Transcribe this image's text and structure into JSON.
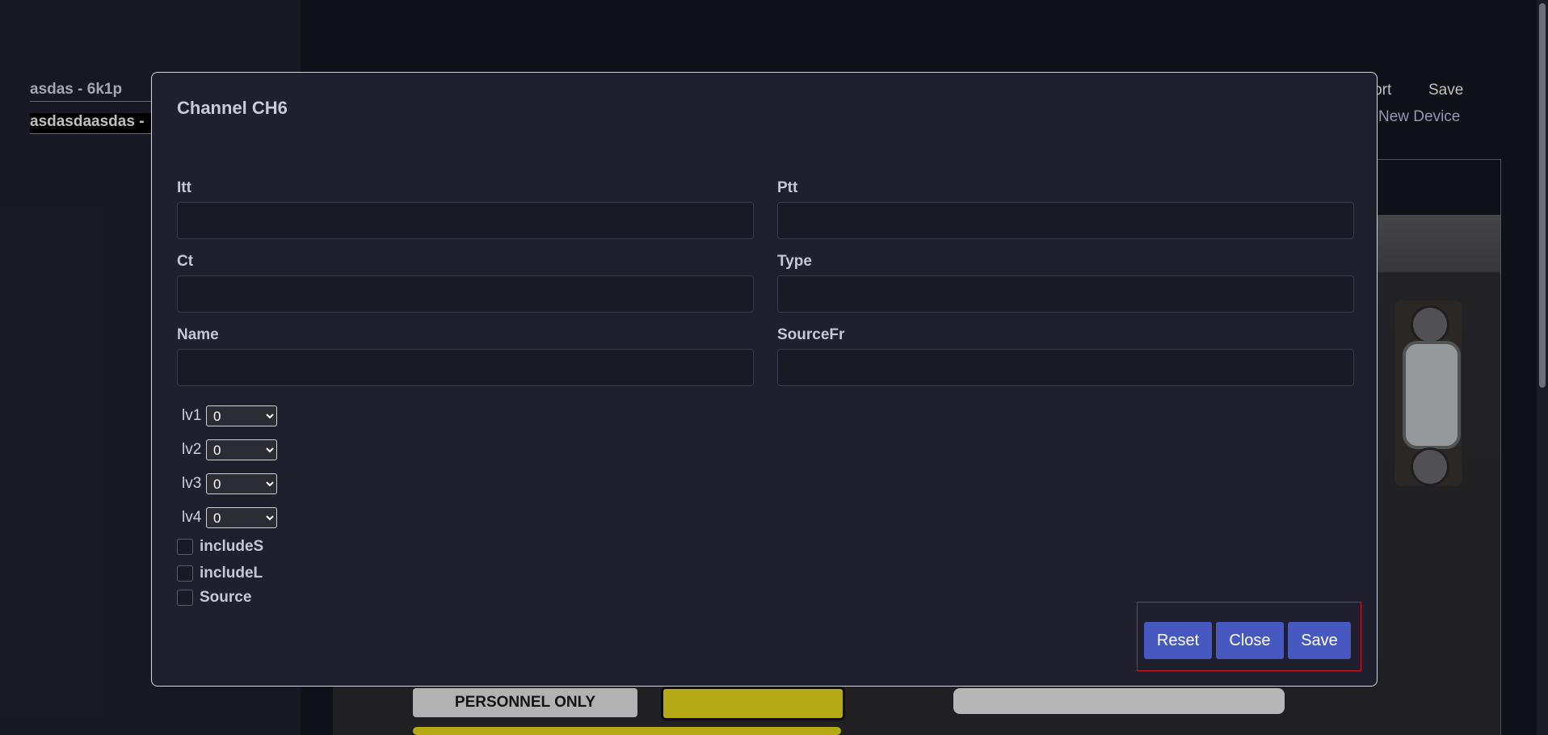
{
  "sidebar": {
    "items": [
      {
        "label": "asdas - 6k1p"
      },
      {
        "label": "asdasdaasdas -"
      }
    ]
  },
  "header": {
    "export_label": "xport",
    "save_label": "Save",
    "new_device_label": "New Device"
  },
  "device_image": {
    "warning_text": "PERSONNEL ONLY"
  },
  "modal": {
    "title": "Channel CH6",
    "fields": {
      "itt": {
        "label": "Itt",
        "value": ""
      },
      "ptt": {
        "label": "Ptt",
        "value": ""
      },
      "ct": {
        "label": "Ct",
        "value": ""
      },
      "type": {
        "label": "Type",
        "value": ""
      },
      "name": {
        "label": "Name",
        "value": ""
      },
      "sourcefr": {
        "label": "SourceFr",
        "value": ""
      }
    },
    "levels": [
      {
        "label": "lv1",
        "value": "0"
      },
      {
        "label": "lv2",
        "value": "0"
      },
      {
        "label": "lv3",
        "value": "0"
      },
      {
        "label": "lv4",
        "value": "0"
      }
    ],
    "checkboxes": [
      {
        "label": "includeS",
        "checked": false
      },
      {
        "label": "includeL",
        "checked": false
      },
      {
        "label": "Source",
        "checked": false
      }
    ],
    "buttons": {
      "reset": "Reset",
      "close": "Close",
      "save": "Save"
    }
  }
}
